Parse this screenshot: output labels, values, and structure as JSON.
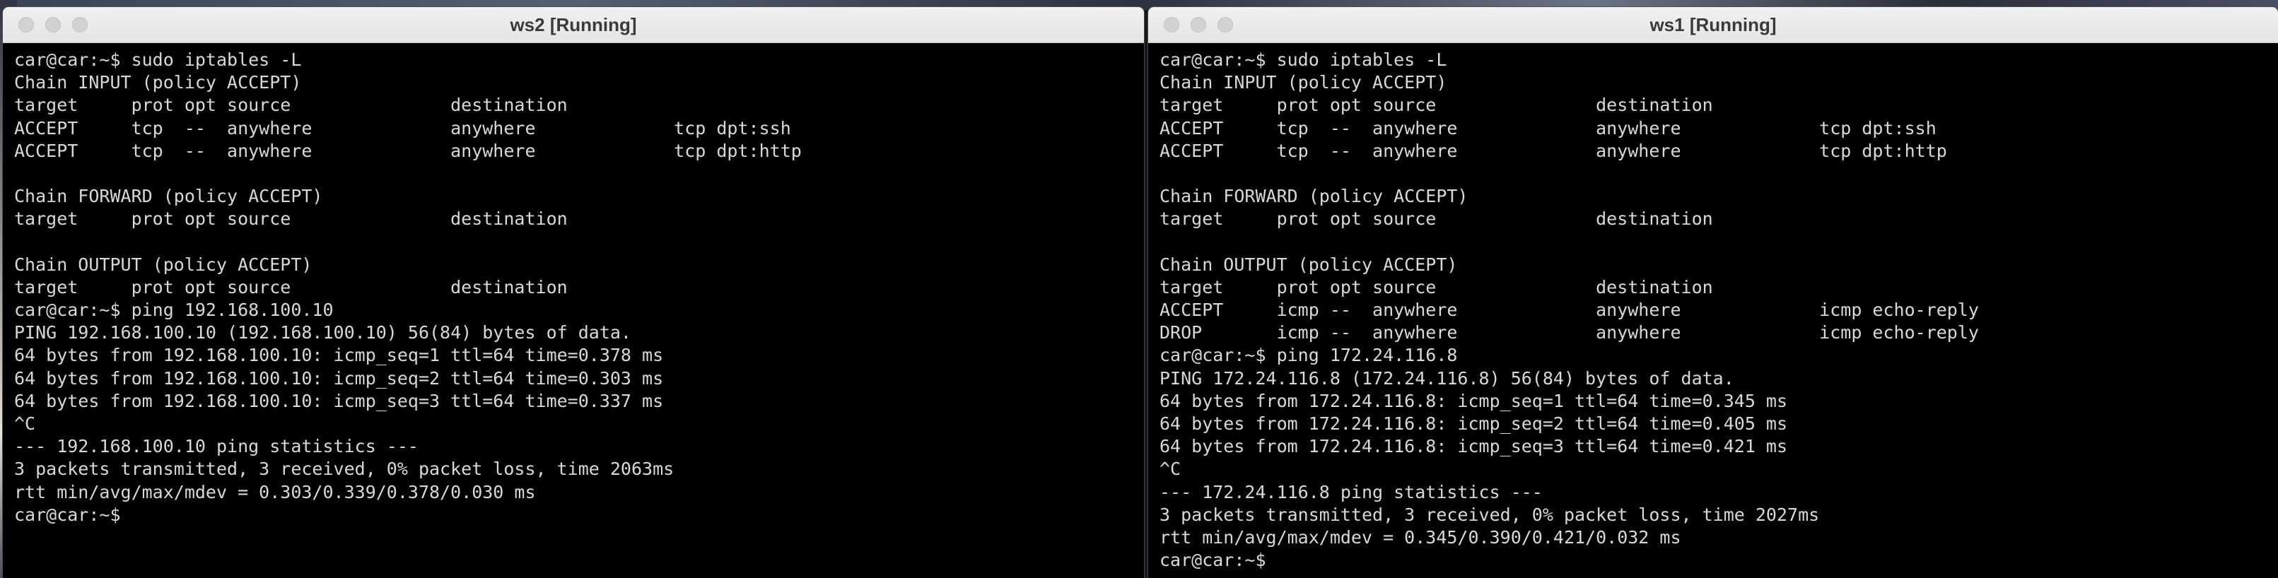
{
  "windows": {
    "ws2": {
      "title": "ws2 [Running]",
      "lines": [
        "car@car:~$ sudo iptables -L",
        "Chain INPUT (policy ACCEPT)",
        "target     prot opt source               destination",
        "ACCEPT     tcp  --  anywhere             anywhere             tcp dpt:ssh",
        "ACCEPT     tcp  --  anywhere             anywhere             tcp dpt:http",
        "",
        "Chain FORWARD (policy ACCEPT)",
        "target     prot opt source               destination",
        "",
        "Chain OUTPUT (policy ACCEPT)",
        "target     prot opt source               destination",
        "car@car:~$ ping 192.168.100.10",
        "PING 192.168.100.10 (192.168.100.10) 56(84) bytes of data.",
        "64 bytes from 192.168.100.10: icmp_seq=1 ttl=64 time=0.378 ms",
        "64 bytes from 192.168.100.10: icmp_seq=2 ttl=64 time=0.303 ms",
        "64 bytes from 192.168.100.10: icmp_seq=3 ttl=64 time=0.337 ms",
        "^C",
        "--- 192.168.100.10 ping statistics ---",
        "3 packets transmitted, 3 received, 0% packet loss, time 2063ms",
        "rtt min/avg/max/mdev = 0.303/0.339/0.378/0.030 ms",
        "car@car:~$ "
      ]
    },
    "ws1": {
      "title": "ws1 [Running]",
      "lines": [
        "car@car:~$ sudo iptables -L",
        "Chain INPUT (policy ACCEPT)",
        "target     prot opt source               destination",
        "ACCEPT     tcp  --  anywhere             anywhere             tcp dpt:ssh",
        "ACCEPT     tcp  --  anywhere             anywhere             tcp dpt:http",
        "",
        "Chain FORWARD (policy ACCEPT)",
        "target     prot opt source               destination",
        "",
        "Chain OUTPUT (policy ACCEPT)",
        "target     prot opt source               destination",
        "ACCEPT     icmp --  anywhere             anywhere             icmp echo-reply",
        "DROP       icmp --  anywhere             anywhere             icmp echo-reply",
        "car@car:~$ ping 172.24.116.8",
        "PING 172.24.116.8 (172.24.116.8) 56(84) bytes of data.",
        "64 bytes from 172.24.116.8: icmp_seq=1 ttl=64 time=0.345 ms",
        "64 bytes from 172.24.116.8: icmp_seq=2 ttl=64 time=0.405 ms",
        "64 bytes from 172.24.116.8: icmp_seq=3 ttl=64 time=0.421 ms",
        "^C",
        "--- 172.24.116.8 ping statistics ---",
        "3 packets transmitted, 3 received, 0% packet loss, time 2027ms",
        "rtt min/avg/max/mdev = 0.345/0.390/0.421/0.032 ms",
        "car@car:~$ "
      ]
    }
  },
  "colors": {
    "terminal_bg": "#000000",
    "terminal_fg": "#d8d8d8",
    "titlebar_bg": "#e9e9e9",
    "traffic_light_inactive": "#d2d2d2"
  }
}
